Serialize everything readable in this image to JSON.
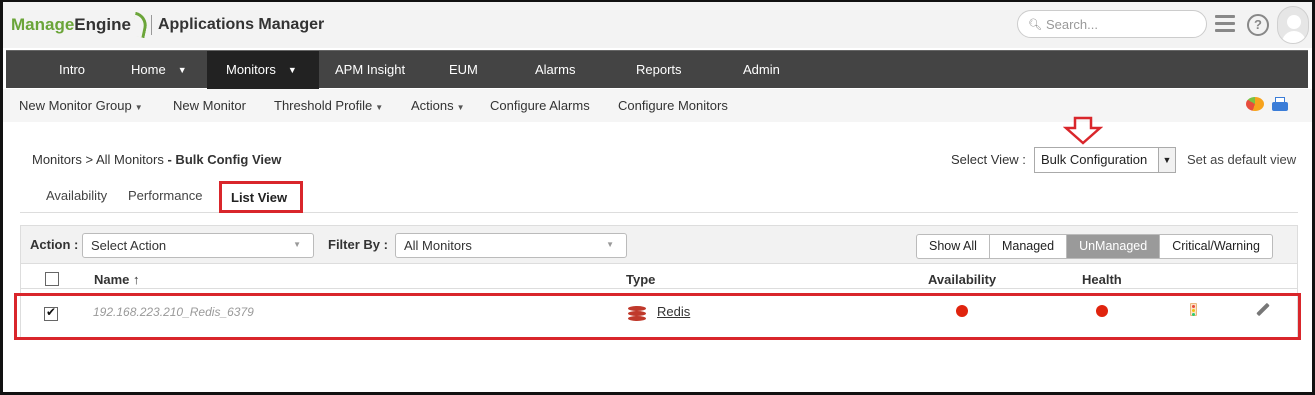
{
  "header": {
    "brand_part1": "Manage",
    "brand_part2": "Engine",
    "product": "Applications Manager",
    "search_placeholder": "Search...",
    "search_icon": "search-icon",
    "help_label": "?"
  },
  "nav": {
    "items": [
      {
        "label": "Intro"
      },
      {
        "label": "Home",
        "has_dropdown": true
      },
      {
        "label": "Monitors",
        "has_dropdown": true,
        "active": true
      },
      {
        "label": "APM Insight"
      },
      {
        "label": "EUM"
      },
      {
        "label": "Alarms"
      },
      {
        "label": "Reports"
      },
      {
        "label": "Admin"
      }
    ]
  },
  "toolbar": {
    "items": [
      {
        "label": "New Monitor Group",
        "has_dropdown": true
      },
      {
        "label": "New Monitor"
      },
      {
        "label": "Threshold Profile",
        "has_dropdown": true
      },
      {
        "label": "Actions",
        "has_dropdown": true
      },
      {
        "label": "Configure Alarms"
      },
      {
        "label": "Configure Monitors"
      }
    ]
  },
  "page": {
    "breadcrumb_prefix": "Monitors > All Monitors",
    "breadcrumb_current": "- Bulk Config View",
    "select_view_label": "Select View :",
    "select_view_value": "Bulk Configuration",
    "set_default_label": "Set as default view",
    "tabs": [
      {
        "label": "Availability"
      },
      {
        "label": "Performance"
      },
      {
        "label": "List View",
        "active": true
      }
    ]
  },
  "filters": {
    "action_label": "Action :",
    "action_value": "Select Action",
    "filter_label": "Filter By :",
    "filter_value": "All Monitors",
    "segments": [
      {
        "label": "Show All"
      },
      {
        "label": "Managed"
      },
      {
        "label": "UnManaged",
        "active": true
      },
      {
        "label": "Critical/Warning"
      }
    ]
  },
  "table": {
    "columns": [
      "Name ↑",
      "Type",
      "Availability",
      "Health"
    ],
    "rows": [
      {
        "checked": true,
        "name": "192.168.223.210_Redis_6379",
        "type": "Redis",
        "availability": "critical",
        "health": "critical"
      }
    ]
  },
  "colors": {
    "accent_red": "#d9262b",
    "status_red": "#e0240e",
    "nav_bg": "#444444",
    "brand_green": "#6ba539"
  }
}
